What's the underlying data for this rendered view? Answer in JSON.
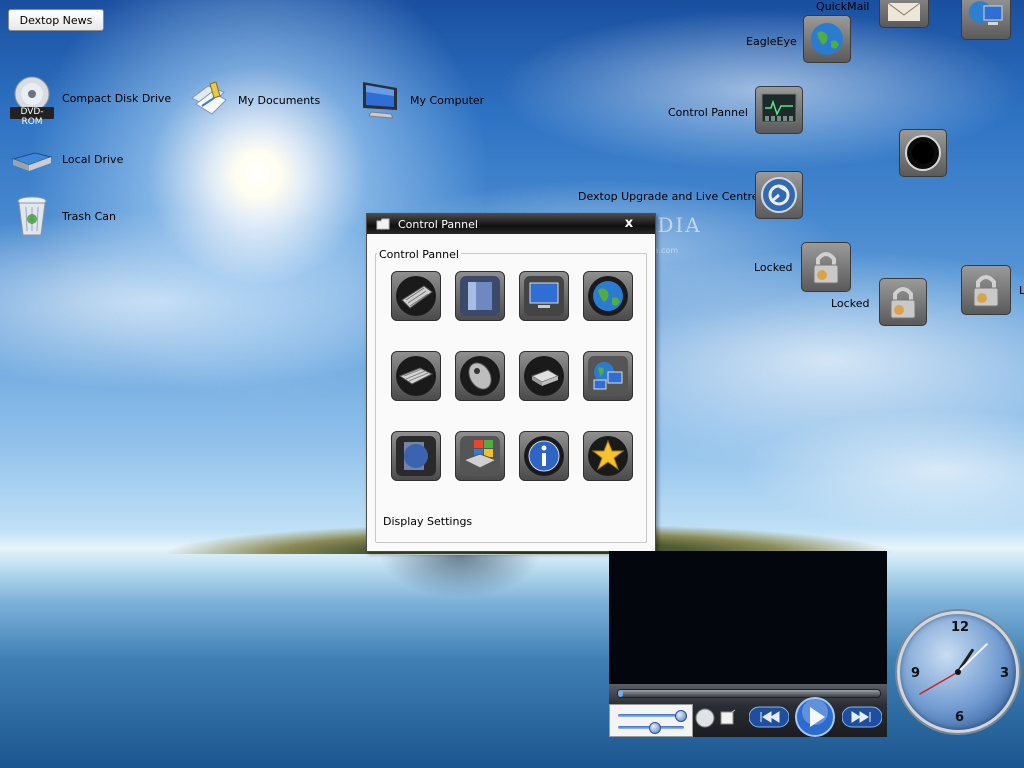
{
  "news_button": {
    "label": "Dextop News"
  },
  "desktop_icons_left": [
    {
      "name": "cd-icon",
      "label": "Compact Disk Drive",
      "badge": "DVD-ROM"
    },
    {
      "name": "documents-icon",
      "label": "My Documents"
    },
    {
      "name": "computer-icon",
      "label": "My Computer"
    },
    {
      "name": "drive-icon",
      "label": "Local Drive"
    },
    {
      "name": "trash-icon",
      "label": "Trash Can"
    }
  ],
  "desktop_icons_right": {
    "quickmail": "QuickMail",
    "eagleeye": "EagleEye",
    "control_pannel": "Control Pannel",
    "upgrade": "Dextop Upgrade and Live Centre",
    "locked1": "Locked",
    "locked2": "Locked",
    "locked3": "L"
  },
  "watermark": {
    "text": "SOFTPEDIA",
    "sub": "www.softpedia.com"
  },
  "control_window": {
    "title": "Control Pannel",
    "close": "x",
    "group_label": "Control Pannel",
    "status": "Display Settings",
    "items": [
      "keyboard-icon",
      "display-icon",
      "monitor-icon",
      "globe-icon",
      "keyboard-2-icon",
      "mouse-icon",
      "printer-icon",
      "network-icon",
      "theme-icon",
      "windows-icon",
      "info-icon",
      "favorites-icon"
    ]
  },
  "clock": {
    "numbers": [
      "12",
      "3",
      "6",
      "9"
    ],
    "time": "1:07:40"
  },
  "player": {
    "volume_level": 0.92,
    "balance_level": 0.5,
    "progress": 0.02
  }
}
